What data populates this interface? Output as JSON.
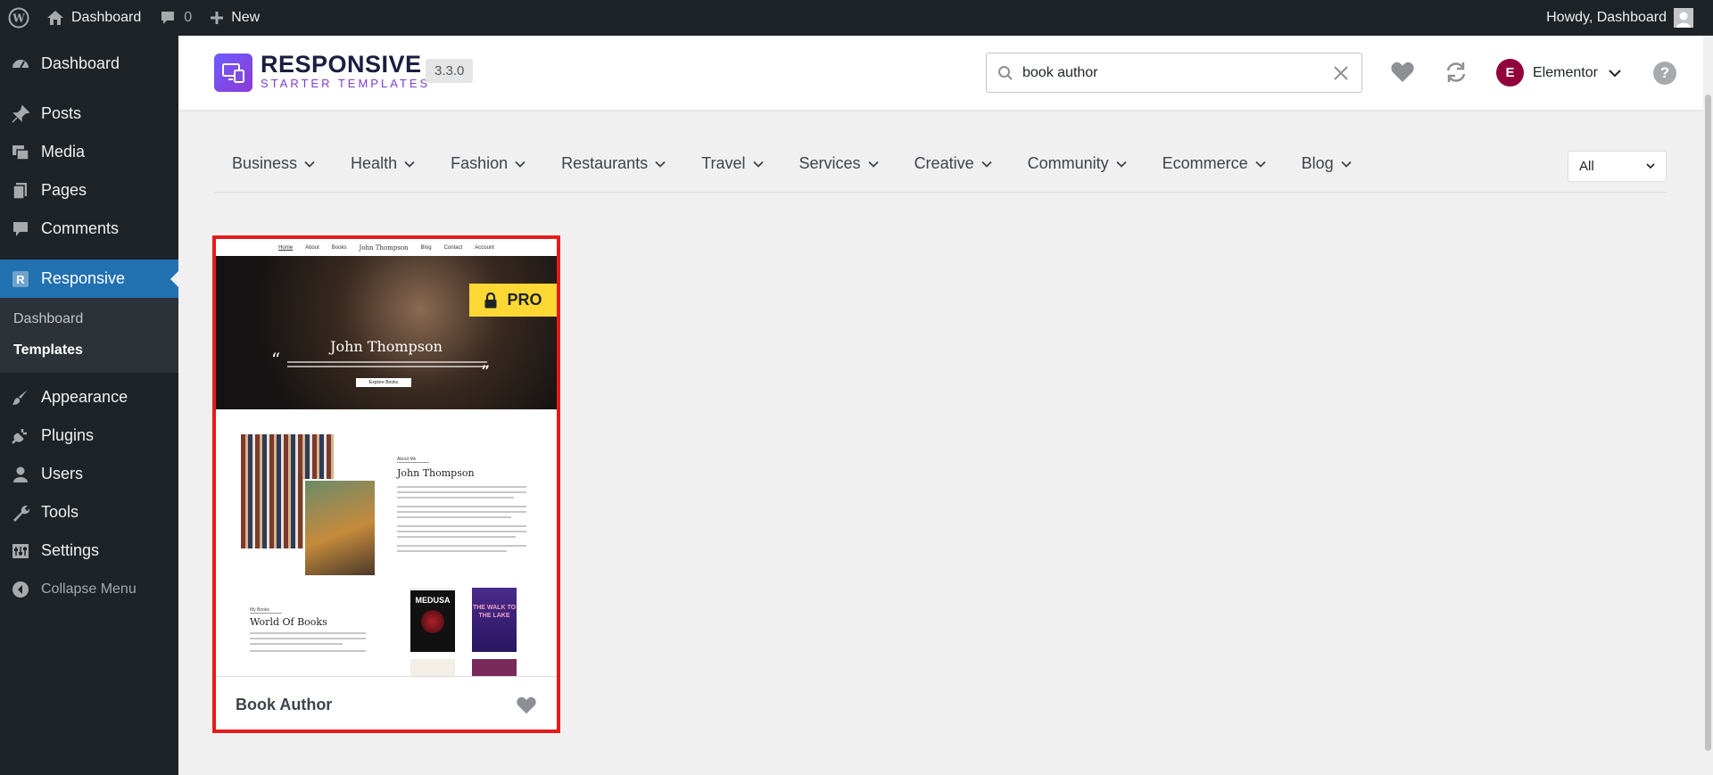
{
  "adminbar": {
    "site_name": "Dashboard",
    "comments_count": "0",
    "new_label": "New",
    "howdy": "Howdy, Dashboard"
  },
  "sidebar": {
    "items": [
      {
        "label": "Dashboard",
        "icon": "dashboard-icon"
      },
      {
        "label": "Posts",
        "icon": "pin-icon"
      },
      {
        "label": "Media",
        "icon": "media-icon"
      },
      {
        "label": "Pages",
        "icon": "pages-icon"
      },
      {
        "label": "Comments",
        "icon": "comment-icon"
      },
      {
        "label": "Responsive",
        "icon": "responsive-icon"
      },
      {
        "label": "Appearance",
        "icon": "brush-icon"
      },
      {
        "label": "Plugins",
        "icon": "plug-icon"
      },
      {
        "label": "Users",
        "icon": "user-icon"
      },
      {
        "label": "Tools",
        "icon": "wrench-icon"
      },
      {
        "label": "Settings",
        "icon": "settings-icon"
      }
    ],
    "submenu": [
      "Dashboard",
      "Templates"
    ],
    "collapse_label": "Collapse Menu"
  },
  "header": {
    "logo_main": "RESPONSIVE",
    "logo_sub": "STARTER TEMPLATES",
    "version": "3.3.0",
    "search_value": "book author",
    "builder": "Elementor",
    "builder_badge": "E",
    "help": "?"
  },
  "categories": [
    "Business",
    "Health",
    "Fashion",
    "Restaurants",
    "Travel",
    "Services",
    "Creative",
    "Community",
    "Ecommerce",
    "Blog"
  ],
  "filter": {
    "selected": "All"
  },
  "template": {
    "title": "Book Author",
    "badge": "PRO",
    "preview": {
      "nav": [
        "Home",
        "About",
        "Books",
        "John Thompson",
        "Blog",
        "Contact",
        "Account"
      ],
      "hero_name": "John Thompson",
      "hero_button": "Explore Books",
      "about_tag": "About Me",
      "about_name": "John Thompson",
      "books_tag": "My Books",
      "books_title": "World Of Books",
      "book1": "MEDUSA",
      "book2": "THE WALK TO THE LAKE"
    }
  },
  "colors": {
    "admin_bg": "#1d2327",
    "accent": "#2271b1",
    "pro_badge": "#fdd835",
    "selection_border": "#e51b1b",
    "elementor": "#92003b"
  }
}
